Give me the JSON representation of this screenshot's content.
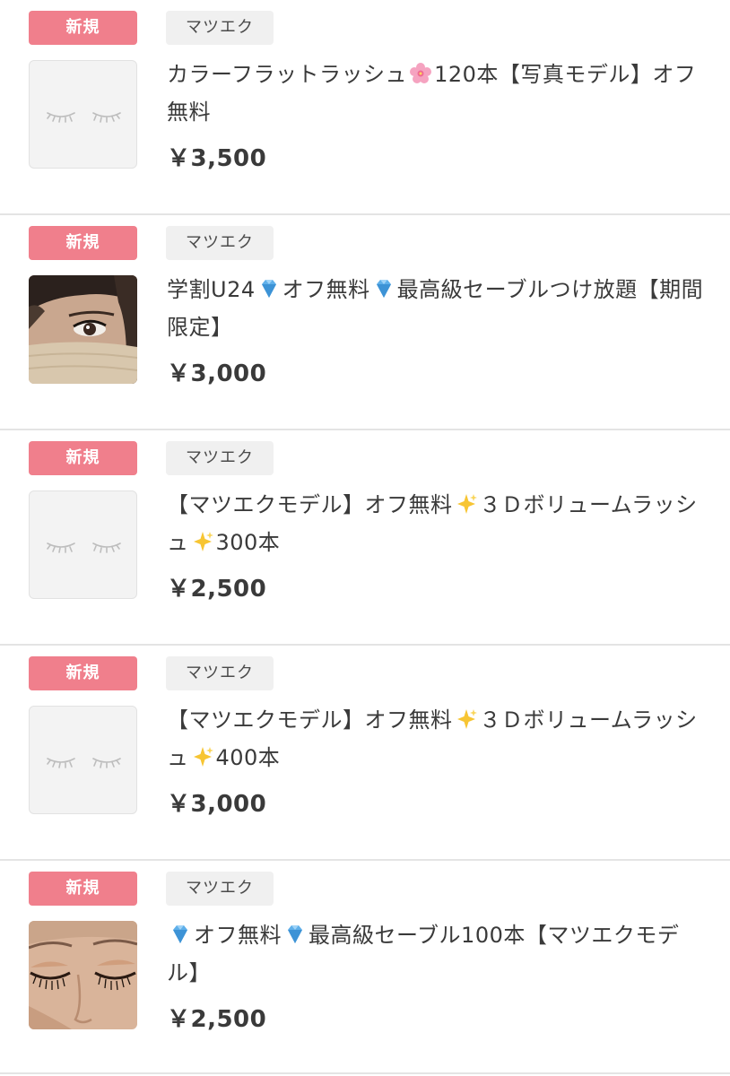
{
  "items": [
    {
      "badge": "新規",
      "category": "マツエク",
      "thumb": "placeholder",
      "title_parts": [
        "カラーフラットラッシュ",
        "🌸",
        "120本【写真モデル】オフ無料"
      ],
      "price": "￥3,500"
    },
    {
      "badge": "新規",
      "category": "マツエク",
      "thumb": "photo-masked-eye",
      "title_parts": [
        "学割U24",
        "💎",
        "オフ無料",
        "💎",
        "最高級セーブルつけ放題【期間限定】"
      ],
      "price": "￥3,000"
    },
    {
      "badge": "新規",
      "category": "マツエク",
      "thumb": "placeholder",
      "title_parts": [
        "【マツエクモデル】オフ無料",
        "✨",
        "３Ｄボリュームラッシュ",
        "✨",
        "300本"
      ],
      "price": "￥2,500"
    },
    {
      "badge": "新規",
      "category": "マツエク",
      "thumb": "placeholder",
      "title_parts": [
        "【マツエクモデル】オフ無料",
        "✨",
        "３Ｄボリュームラッシュ",
        "✨",
        "400本"
      ],
      "price": "￥3,000"
    },
    {
      "badge": "新規",
      "category": "マツエク",
      "thumb": "photo-closed-eyes",
      "title_parts": [
        "💎",
        "オフ無料",
        "💎",
        "最高級セーブル100本【マツエクモデル】"
      ],
      "price": "￥2,500"
    }
  ],
  "icons": {
    "flower": "cherry-blossom-icon",
    "gem": "gem-icon",
    "sparkles": "sparkles-icon",
    "placeholder": "closed-eyelashes-icon"
  },
  "colors": {
    "badge_new": "#f07f8c",
    "tag_bg": "#f0f0f0",
    "divider": "#e4e4e4"
  }
}
